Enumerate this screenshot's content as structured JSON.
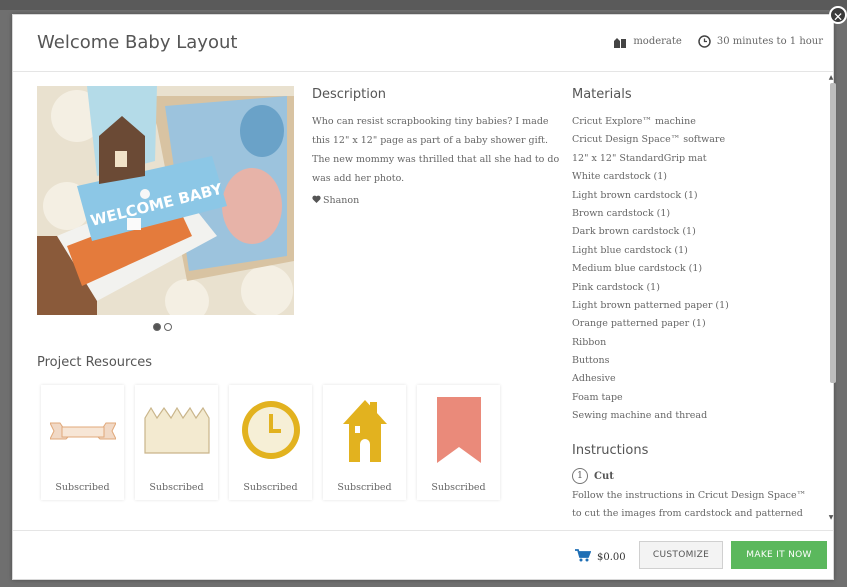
{
  "modal": {
    "title": "Welcome Baby Layout",
    "difficulty": "moderate",
    "time": "30 minutes to 1 hour"
  },
  "description": {
    "heading": "Description",
    "text": "Who can resist scrapbooking tiny babies? I made this 12\" x 12\" page as part of a baby shower gift. The new mommy was thrilled that all she had to do was add her photo.",
    "author": "Shanon"
  },
  "gallery": {
    "current": 1,
    "total": 2
  },
  "resources": {
    "heading": "Project Resources",
    "items": [
      {
        "label": "Subscribed",
        "icon": "banner-ribbon-icon"
      },
      {
        "label": "Subscribed",
        "icon": "scalloped-border-icon"
      },
      {
        "label": "Subscribed",
        "icon": "clock-icon"
      },
      {
        "label": "Subscribed",
        "icon": "house-icon"
      },
      {
        "label": "Subscribed",
        "icon": "pennant-flag-icon"
      }
    ]
  },
  "materials": {
    "heading": "Materials",
    "items": [
      "Cricut Explore™ machine",
      "Cricut Design Space™ software",
      "12\" x 12\" StandardGrip mat",
      "White cardstock (1)",
      "Light brown cardstock (1)",
      "Brown cardstock (1)",
      "Dark brown cardstock (1)",
      "Light blue cardstock (1)",
      "Medium blue cardstock (1)",
      "Pink cardstock (1)",
      "Light brown patterned paper (1)",
      "Orange patterned paper (1)",
      "Ribbon",
      "Buttons",
      "Adhesive",
      "Foam tape",
      "Sewing machine and thread"
    ]
  },
  "instructions": {
    "heading": "Instructions",
    "step_number": "1",
    "step_title": "Cut",
    "step_text": "Follow the instructions in Cricut Design Space™ to cut the images from cardstock and patterned"
  },
  "footer": {
    "price": "$0.00",
    "customize_label": "CUSTOMIZE",
    "make_label": "MAKE IT NOW"
  },
  "colors": {
    "make_button": "#5bb85d",
    "resource_gold": "#e2b21f",
    "resource_pink": "#ea8a7a"
  }
}
